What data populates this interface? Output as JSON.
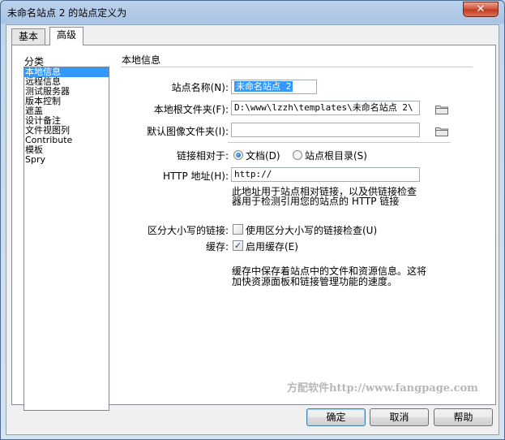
{
  "window": {
    "title": "未命名站点 2 的站点定义为",
    "close_glyph": "✕"
  },
  "tabs": [
    {
      "label": "基本"
    },
    {
      "label": "高级"
    }
  ],
  "category": {
    "label": "分类",
    "items": [
      "本地信息",
      "远程信息",
      "测试服务器",
      "版本控制",
      "遮盖",
      "设计备注",
      "文件视图列",
      "Contribute",
      "模板",
      "Spry"
    ],
    "selected_index": 0
  },
  "local_info": {
    "section_title": "本地信息",
    "site_name": {
      "label": "站点名称(N):",
      "value": "未命名站点 2"
    },
    "local_root": {
      "label": "本地根文件夹(F):",
      "value": "D:\\www\\lzzh\\templates\\未命名站点 2\\"
    },
    "default_images": {
      "label": "默认图像文件夹(I):",
      "value": ""
    },
    "links_relative": {
      "label": "链接相对于:",
      "options": [
        {
          "label": "文档(D)",
          "checked": true
        },
        {
          "label": "站点根目录(S)",
          "checked": false
        }
      ]
    },
    "http_address": {
      "label": "HTTP 地址(H):",
      "value": "http://"
    },
    "http_note": [
      "此地址用于站点相对链接，以及供链接检查",
      "器用于检测引用您的站点的 HTTP 链接"
    ],
    "case_sensitive": {
      "label": "区分大小写的链接:",
      "option": "使用区分大小写的链接检查(U)",
      "checked": false
    },
    "cache": {
      "label": "缓存:",
      "option": "启用缓存(E)",
      "checked": true
    },
    "cache_note": [
      "缓存中保存着站点中的文件和资源信息。这将",
      "加快资源面板和链接管理功能的速度。"
    ]
  },
  "watermark": "方配软件http://www.fangpage.com",
  "buttons": {
    "ok": "确定",
    "cancel": "取消",
    "help": "帮助"
  },
  "icons": {
    "close": "close-icon",
    "folder": "folder-icon"
  },
  "colors": {
    "selection": "#3399ff",
    "title_bar": "#a9c3e3",
    "close_button": "#c03c22"
  }
}
